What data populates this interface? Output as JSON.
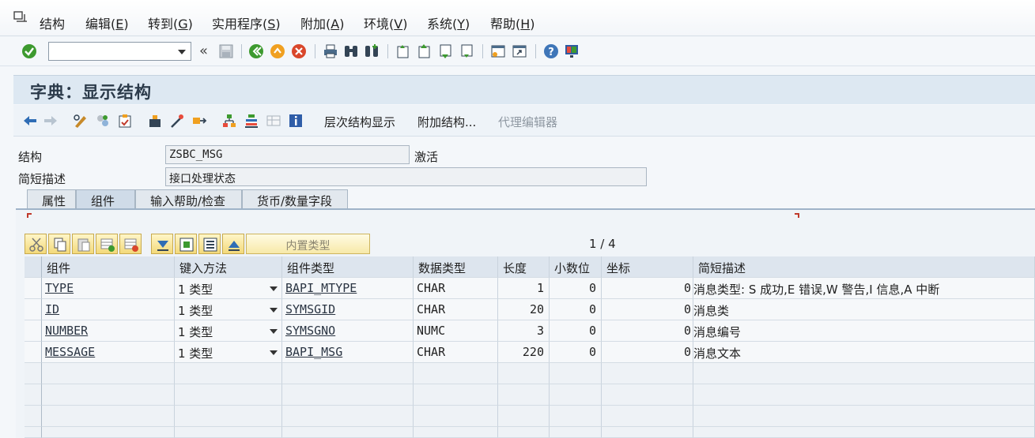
{
  "menu": {
    "items": [
      {
        "label": "结构",
        "hotkey": ""
      },
      {
        "label": "编辑(",
        "hotkey": "E",
        "tail": ")"
      },
      {
        "label": "转到(",
        "hotkey": "G",
        "tail": ")"
      },
      {
        "label": "实用程序(",
        "hotkey": "S",
        "tail": ")"
      },
      {
        "label": "附加(",
        "hotkey": "A",
        "tail": ")"
      },
      {
        "label": "环境(",
        "hotkey": "V",
        "tail": ")"
      },
      {
        "label": "系统(",
        "hotkey": "Y",
        "tail": ")"
      },
      {
        "label": "帮助(",
        "hotkey": "H",
        "tail": ")"
      }
    ]
  },
  "systoolbar": {
    "command_value": "",
    "more": "«"
  },
  "title": "字典：显示结构",
  "apptoolbar": {
    "hierarchy_label": "层次结构显示",
    "append_label": "附加结构...",
    "proxy_label": "代理编辑器"
  },
  "header": {
    "structure_label": "结构",
    "structure_value": "ZSBC_MSG",
    "status": "激活",
    "desc_label": "简短描述",
    "desc_value": "接口处理状态"
  },
  "tabs": [
    "属性",
    "组件",
    "输入帮助/检查",
    "货币/数量字段"
  ],
  "table_toolbar": {
    "builtin_label": "内置类型",
    "pager": "1 / 4"
  },
  "table": {
    "columns": [
      "组件",
      "键入方法",
      "组件类型",
      "数据类型",
      "长度",
      "小数位",
      "坐标",
      "简短描述"
    ],
    "rows": [
      {
        "component": "TYPE",
        "method": "1 类型",
        "comp_type": "BAPI_MTYPE",
        "data_type": "CHAR",
        "length": "1",
        "decimals": "0",
        "coord": "0",
        "desc": "消息类型: S 成功,E 错误,W 警告,I 信息,A 中断"
      },
      {
        "component": "ID",
        "method": "1 类型",
        "comp_type": "SYMSGID",
        "data_type": "CHAR",
        "length": "20",
        "decimals": "0",
        "coord": "0",
        "desc": "消息类"
      },
      {
        "component": "NUMBER",
        "method": "1 类型",
        "comp_type": "SYMSGNO",
        "data_type": "NUMC",
        "length": "3",
        "decimals": "0",
        "coord": "0",
        "desc": "消息编号"
      },
      {
        "component": "MESSAGE",
        "method": "1 类型",
        "comp_type": "BAPI_MSG",
        "data_type": "CHAR",
        "length": "220",
        "decimals": "0",
        "coord": "0",
        "desc": "消息文本"
      }
    ]
  },
  "colors": {
    "accent": "#dde8f2",
    "ok_green": "#3d9a2f",
    "cancel_red": "#d9472b"
  }
}
